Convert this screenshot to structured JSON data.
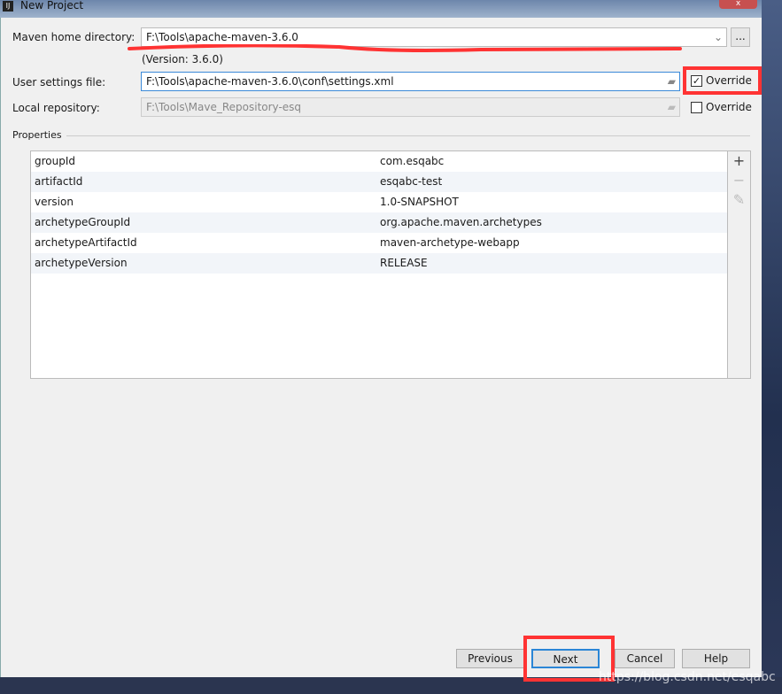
{
  "window": {
    "title": "New Project",
    "close": "x",
    "app_icon": "IJ"
  },
  "maven_home": {
    "label": "Maven home directory:",
    "value": "F:\\Tools\\apache-maven-3.6.0",
    "version": "(Version: 3.6.0)",
    "browse": "..."
  },
  "user_settings": {
    "label": "User settings file:",
    "value": "F:\\Tools\\apache-maven-3.6.0\\conf\\settings.xml",
    "override": "Override",
    "override_checked": true
  },
  "local_repo": {
    "label": "Local repository:",
    "value": "F:\\Tools\\Mave_Repository-esq",
    "override": "Override",
    "override_checked": false
  },
  "properties": {
    "label": "Properties",
    "rows": [
      {
        "key": "groupId",
        "value": "com.esqabc"
      },
      {
        "key": "artifactId",
        "value": "esqabc-test"
      },
      {
        "key": "version",
        "value": "1.0-SNAPSHOT"
      },
      {
        "key": "archetypeGroupId",
        "value": "org.apache.maven.archetypes"
      },
      {
        "key": "archetypeArtifactId",
        "value": "maven-archetype-webapp"
      },
      {
        "key": "archetypeVersion",
        "value": "RELEASE"
      }
    ],
    "tools": {
      "add": "+",
      "remove": "−",
      "edit": "✎"
    }
  },
  "buttons": {
    "previous": "Previous",
    "next": "Next",
    "cancel": "Cancel",
    "help": "Help"
  },
  "watermark": "https://blog.csdn.net/esqabc",
  "colors": {
    "annotation": "#ff3333",
    "focus": "#2b86d6"
  }
}
